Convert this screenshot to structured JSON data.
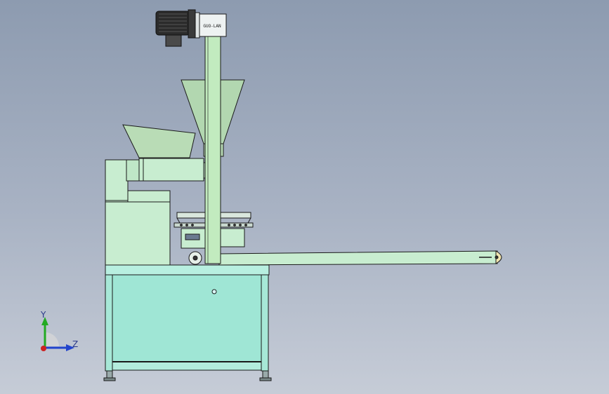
{
  "machine": {
    "gearbox_label": "GUO-LAN"
  },
  "triad": {
    "y_label": "Y",
    "z_label": "Z"
  },
  "colors": {
    "frame_body": "#a7e8d7",
    "frame_dark": "#8fd8c6",
    "upper_body": "#c8edd0",
    "hopper": "#b9dcb6",
    "rod": "#c2ebbf",
    "outline": "#1a1a1a",
    "motor": "#2b2b2b",
    "axis_y": "#22aa22",
    "axis_z": "#2244cc",
    "origin": "#cc2222"
  }
}
